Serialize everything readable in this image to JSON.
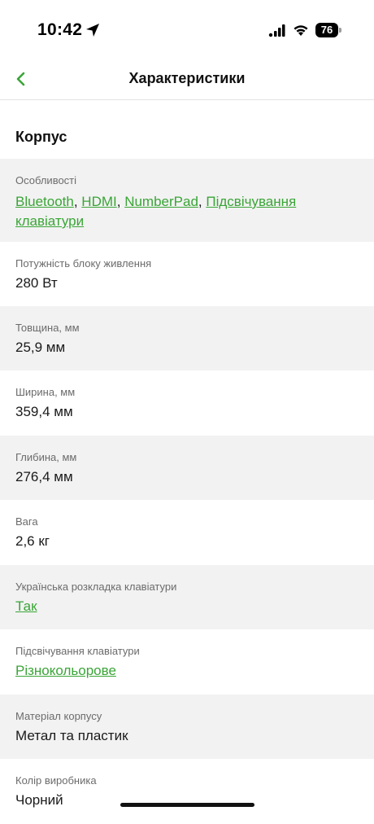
{
  "status_bar": {
    "time": "10:42",
    "battery": "76"
  },
  "nav": {
    "title": "Характеристики"
  },
  "section": {
    "title": "Корпус"
  },
  "features": {
    "label": "Особливості",
    "items": [
      "Bluetooth",
      "HDMI",
      "NumberPad",
      "Підсвічування клавіатури"
    ],
    "separator": ", "
  },
  "specs": [
    {
      "label": "Потужність блоку живлення",
      "value": "280 Вт"
    },
    {
      "label": "Товщина, мм",
      "value": "25,9 мм"
    },
    {
      "label": "Ширина, мм",
      "value": "359,4 мм"
    },
    {
      "label": "Глибина, мм",
      "value": "276,4 мм"
    },
    {
      "label": "Вага",
      "value": "2,6 кг"
    },
    {
      "label": "Українська розкладка клавіатури",
      "value": "Так"
    },
    {
      "label": "Підсвічування клавіатури",
      "value": "Різнокольорове"
    },
    {
      "label": "Матеріал корпусу",
      "value": "Метал та пластик"
    },
    {
      "label": "Колір виробника",
      "value": "Чорний"
    }
  ],
  "colors": {
    "accent": "#3aa537",
    "shaded_row": "#f2f2f2"
  }
}
